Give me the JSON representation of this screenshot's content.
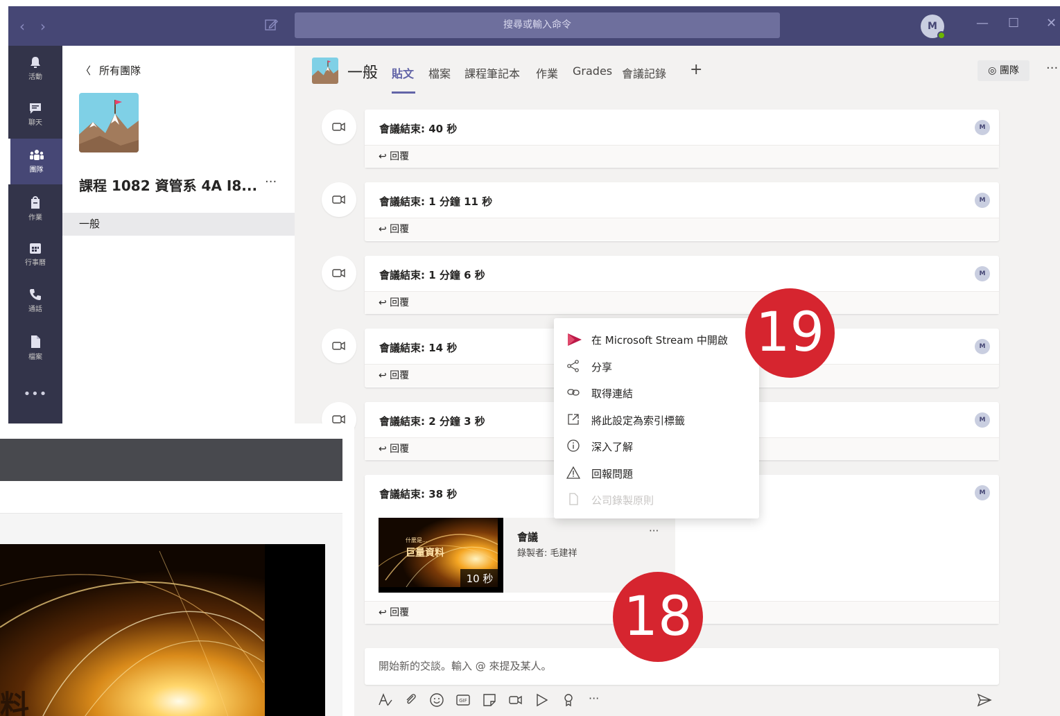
{
  "titlebar": {
    "search_placeholder": "搜尋或輸入命令",
    "avatar_initial": "M",
    "back": "‹",
    "forward": "›",
    "minimize": "—",
    "maximize": "☐",
    "close": "✕"
  },
  "rail": {
    "items": [
      {
        "label": "活動",
        "icon": "bell-icon"
      },
      {
        "label": "聊天",
        "icon": "chat-icon"
      },
      {
        "label": "團隊",
        "icon": "teams-icon"
      },
      {
        "label": "作業",
        "icon": "assignments-icon"
      },
      {
        "label": "行事曆",
        "icon": "calendar-icon"
      },
      {
        "label": "通話",
        "icon": "phone-icon"
      },
      {
        "label": "檔案",
        "icon": "files-icon"
      }
    ],
    "more": "•••"
  },
  "team_panel": {
    "back_label": "所有團隊",
    "team_name": "課程 1082 資管系 4A I8...",
    "more": "···",
    "channel": "一般"
  },
  "channel_header": {
    "title": "一般",
    "tabs": [
      "貼文",
      "檔案",
      "課程筆記本",
      "作業",
      "Grades",
      "會議記錄",
      "+"
    ],
    "team_button": "◎ 團隊",
    "more": "···"
  },
  "posts": [
    {
      "title": "會議結束: 40 秒",
      "reply": "↩ 回覆",
      "avatar": "M"
    },
    {
      "title": "會議結束: 1 分鐘 11 秒",
      "reply": "↩ 回覆",
      "avatar": "M"
    },
    {
      "title": "會議結束: 1 分鐘 6 秒",
      "reply": "↩ 回覆",
      "avatar": "M"
    },
    {
      "title": "會議結束: 14 秒",
      "reply": "↩ 回覆",
      "avatar": "M"
    },
    {
      "title": "會議結束: 2 分鐘 3 秒",
      "reply": "↩ 回覆",
      "avatar": "M"
    },
    {
      "title": "會議結束: 38 秒",
      "reply": "↩ 回覆",
      "avatar": "M"
    }
  ],
  "recording": {
    "title": "會議",
    "recorded_by": "錄製者: 毛建祥",
    "duration": "10 秒",
    "thumb_caption_small": "什麼是...",
    "thumb_caption": "巨量資料",
    "more": "···"
  },
  "context_menu": {
    "items": [
      {
        "label": "在 Microsoft Stream 中開啟",
        "icon": "stream-icon",
        "disabled": false
      },
      {
        "label": "分享",
        "icon": "share-icon",
        "disabled": false
      },
      {
        "label": "取得連結",
        "icon": "link-icon",
        "disabled": false
      },
      {
        "label": "將此設定為索引標籤",
        "icon": "open-external-icon",
        "disabled": false
      },
      {
        "label": "深入了解",
        "icon": "info-icon",
        "disabled": false
      },
      {
        "label": "回報問題",
        "icon": "warning-icon",
        "disabled": false
      },
      {
        "label": "公司錄製原則",
        "icon": "document-icon",
        "disabled": true
      }
    ]
  },
  "compose": {
    "placeholder": "開始新的交談。輸入 @ 來提及某人。",
    "more": "···"
  },
  "badges": {
    "first": "19",
    "second": "18"
  },
  "stream_video": {
    "partial_caption": "料"
  },
  "colors": {
    "titlebar": "#464775",
    "rail": "#33344a",
    "accent": "#6264a7",
    "badge": "#d6252f",
    "stream_brand": "#bc1948"
  }
}
